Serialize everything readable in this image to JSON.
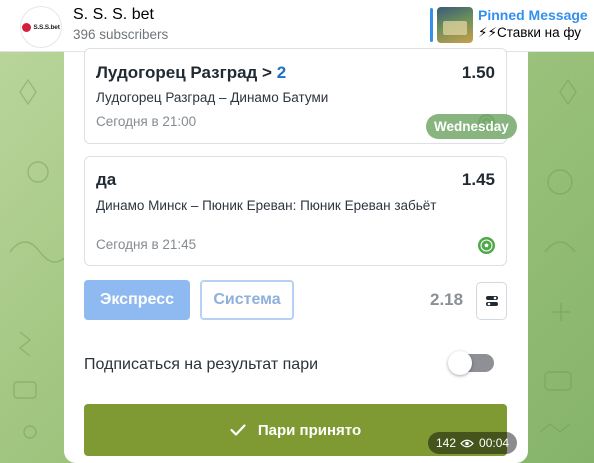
{
  "header": {
    "avatar_text": "S.S.S.bet",
    "title": "S. S. S. bet",
    "subscribers": "396 subscribers",
    "pinned_title": "Pinned Message",
    "pinned_text": "⚡⚡Ставки на фу"
  },
  "bets": [
    {
      "selection_prefix": "Лудогорец Разград > ",
      "selection_value": "2",
      "odds": "1.50",
      "match": "Лудогорец Разград – Динамо Батуми",
      "time": "Сегодня в 21:00"
    },
    {
      "selection_prefix": "да",
      "selection_value": "",
      "odds": "1.45",
      "match": "Динамо Минск – Пюник Ереван: Пюник Ереван забьёт",
      "time": "Сегодня в 21:45"
    }
  ],
  "day_chip": "Wednesday",
  "controls": {
    "express_label": "Экспресс",
    "system_label": "Система",
    "total_odds": "2.18",
    "subscribe_label": "Подписаться на результат пари",
    "subscribe_on": false,
    "accept_label": "Пари принято"
  },
  "meta": {
    "views": "142",
    "duration": "00:04"
  },
  "colors": {
    "accent_blue": "#3390ec",
    "accept_green": "#7f9a33",
    "ball_green": "#4fa84a"
  }
}
